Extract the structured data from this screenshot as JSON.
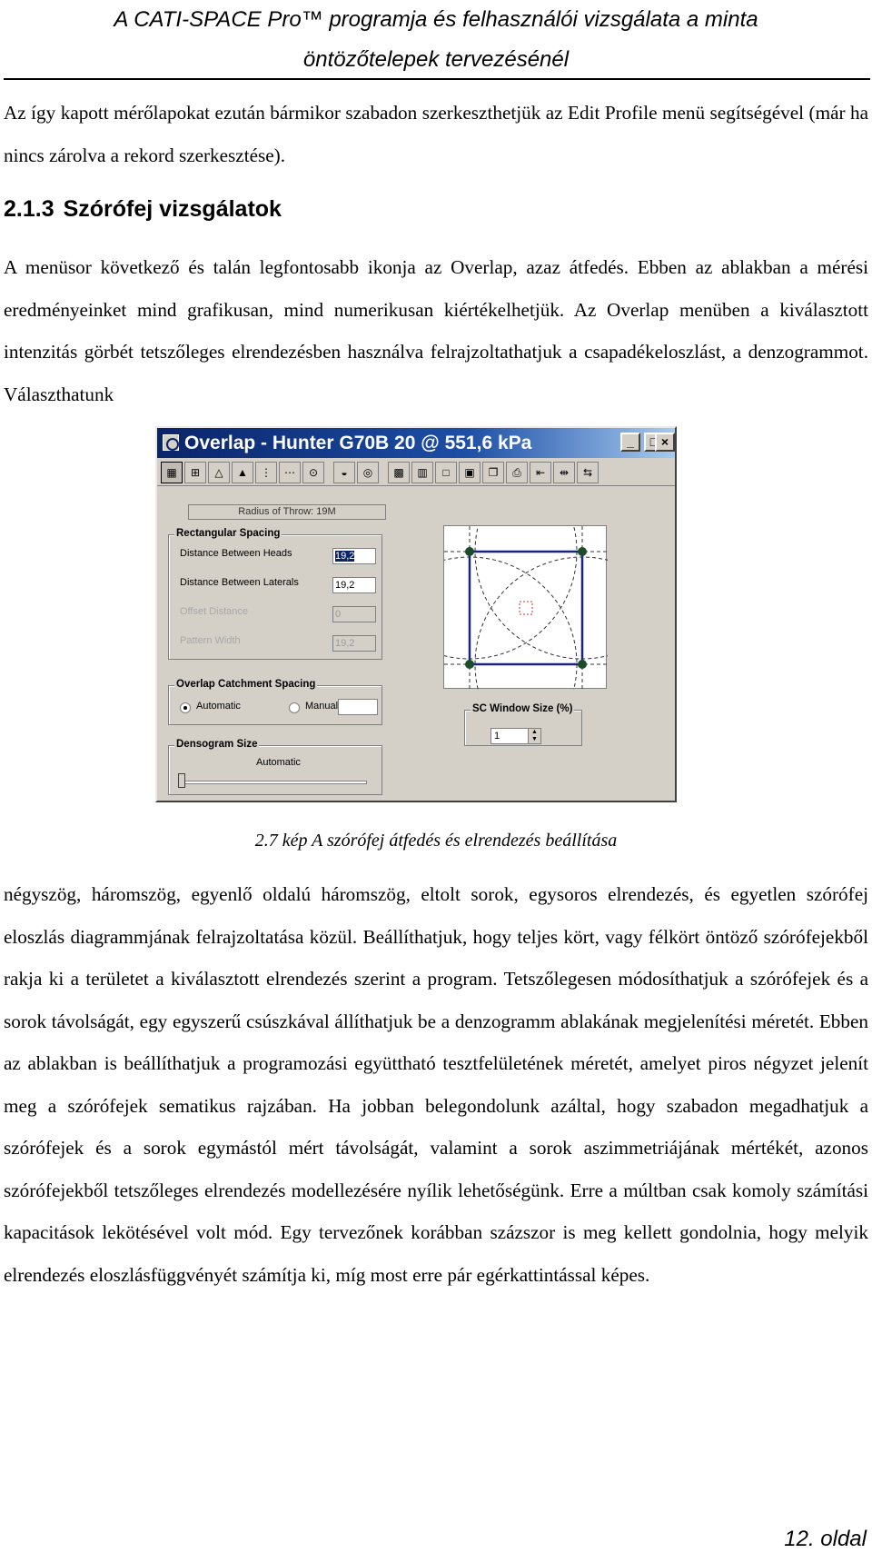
{
  "header": {
    "line1": "A CATI-SPACE Pro™ programja és felhasználói vizsgálata a minta",
    "line2": "öntözőtelepek tervezésénél"
  },
  "paragraph_top": "Az így kapott mérőlapokat ezután bármikor szabadon szerkeszthetjük az Edit Profile menü segítségével (már ha nincs zárolva a rekord szerkesztése).",
  "section": {
    "number": "2.1.3",
    "title": "Szórófej vizsgálatok"
  },
  "paragraph_intro": "A menüsor következő és talán legfontosabb ikonja az Overlap, azaz átfedés. Ebben az ablakban a mérési eredményeinket mind grafikusan, mind numerikusan kiértékelhetjük. Az Overlap menüben a kiválasztott intenzitás görbét tetszőleges elrendezésben használva felrajzoltathatjuk a csapadékeloszlást, a denzogrammot. Választhatunk",
  "figure": {
    "window_title": "Overlap - Hunter G70B 20 @ 551,6 kPa",
    "window_buttons": [
      "_",
      "□",
      "×"
    ],
    "toolbar_icons": [
      "grid-full-icon",
      "grid-heads-icon",
      "triangle-icon",
      "equilateral-icon",
      "offset-rows-icon",
      "single-row-icon",
      "single-head-icon",
      "half-circle-icon",
      "full-circle-icon",
      "densogram-icon",
      "histogram-icon",
      "window-icon",
      "save-icon",
      "copy-icon",
      "print-icon",
      "spacing-icon",
      "move-heads-icon",
      "move-laterals-icon"
    ],
    "radius_of_throw": "Radius of Throw: 19M",
    "rectangular_spacing": {
      "title": "Rectangular Spacing",
      "fields": [
        {
          "label": "Distance Between Heads",
          "value": "19,2"
        },
        {
          "label": "Distance Between Laterals",
          "value": "19,2"
        },
        {
          "label": "Offset Distance",
          "value": "0"
        },
        {
          "label": "Pattern Width",
          "value": "19,2"
        }
      ]
    },
    "overlap_catchment": {
      "title": "Overlap Catchment Spacing",
      "option_automatic": "Automatic",
      "option_manual": "Manual",
      "manual_value": ""
    },
    "densogram_size": {
      "title": "Densogram Size",
      "value_label": "Automatic"
    },
    "sc_window": {
      "title": "SC Window Size (%)",
      "value": "1"
    }
  },
  "caption": "2.7 kép A szórófej átfedés és elrendezés beállítása",
  "paragraph_main": "négyszög, háromszög, egyenlő oldalú háromszög, eltolt sorok, egysoros elrendezés, és egyetlen szórófej eloszlás diagrammjának felrajzoltatása közül. Beállíthatjuk, hogy teljes kört, vagy félkört öntöző szórófejekből rakja ki a területet a kiválasztott elrendezés szerint a program. Tetszőlegesen módosíthatjuk a szórófejek és a sorok távolságát, egy egyszerű csúszkával állíthatjuk be a denzogramm ablakának megjelenítési méretét. Ebben az ablakban is beállíthatjuk a programozási együttható tesztfelületének méretét, amelyet piros négyzet jelenít meg a szórófejek sematikus rajzában. Ha jobban belegondolunk azáltal, hogy szabadon megadhatjuk a szórófejek és a sorok egymástól mért távolságát, valamint a sorok aszimmetriájának mértékét, azonos szórófejekből tetszőleges elrendezés modellezésére nyílik lehetőségünk. Erre a múltban csak komoly számítási kapacitások lekötésével volt mód. Egy tervezőnek korábban százszor is meg kellett gondolnia, hogy melyik elrendezés eloszlásfüggvényét számítja ki, míg most erre pár egérkattintással képes.",
  "page_number": "12. oldal"
}
